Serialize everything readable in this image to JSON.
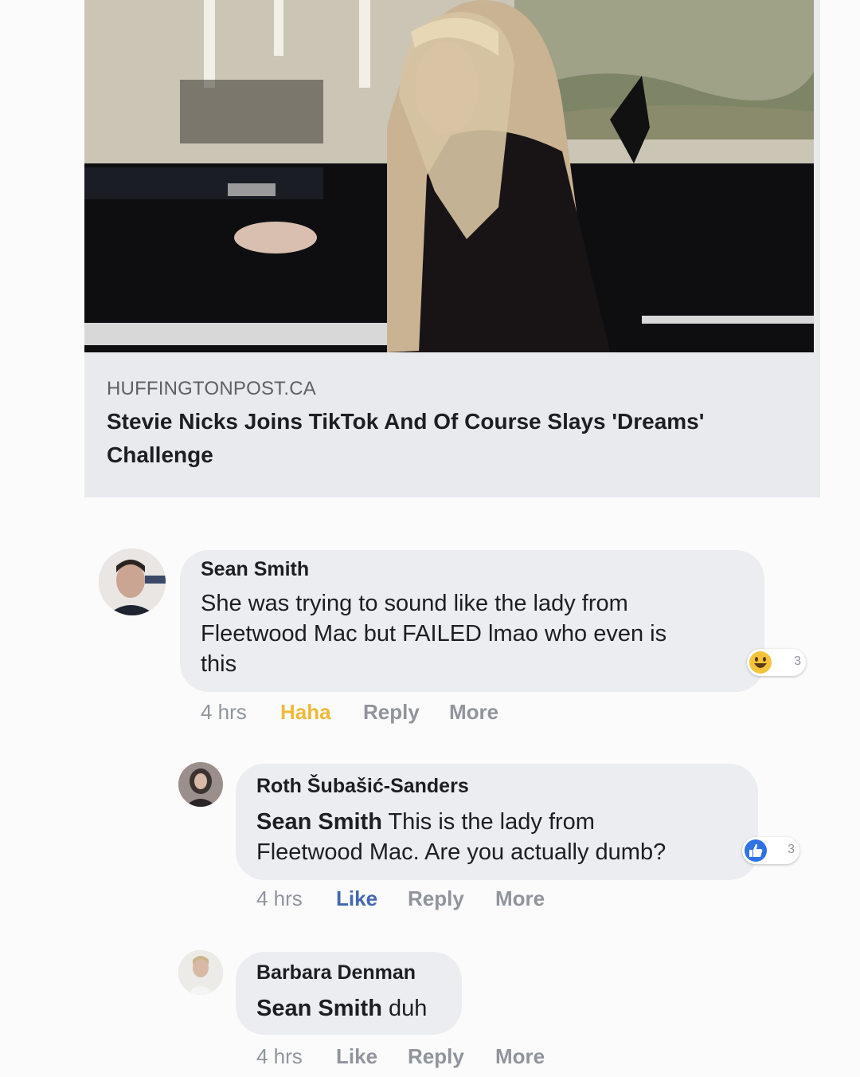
{
  "link_preview": {
    "domain": "HUFFINGTONPOST.CA",
    "headline": "Stevie Nicks Joins TikTok And Of Course Slays 'Dreams' Challenge"
  },
  "comments": [
    {
      "author": "Sean Smith",
      "text_lines": [
        "She was trying to sound like the lady from",
        "Fleetwood Mac but FAILED lmao who even is",
        "this"
      ],
      "reaction": {
        "icon": "haha-emoji-icon",
        "count": "3"
      },
      "time": "4 hrs",
      "actions": {
        "react": "Haha",
        "reply": "Reply",
        "more": "More"
      }
    },
    {
      "author": "Roth Šubašić-Sanders",
      "mention": "Sean Smith",
      "text_lines": [
        " This is the lady from",
        "Fleetwood Mac. Are you actually dumb?"
      ],
      "reaction": {
        "icon": "like-thumb-icon",
        "count": "3"
      },
      "time": "4 hrs",
      "actions": {
        "react": "Like",
        "reply": "Reply",
        "more": "More"
      }
    },
    {
      "author": "Barbara Denman",
      "mention": "Sean Smith",
      "text": " duh",
      "time": "4 hrs",
      "actions": {
        "react": "Like",
        "reply": "Reply",
        "more": "More"
      }
    }
  ],
  "colors": {
    "bubble": "#ecedf1",
    "meta_text": "#90949c",
    "haha": "#f0b93b",
    "like_active": "#4267b2"
  }
}
